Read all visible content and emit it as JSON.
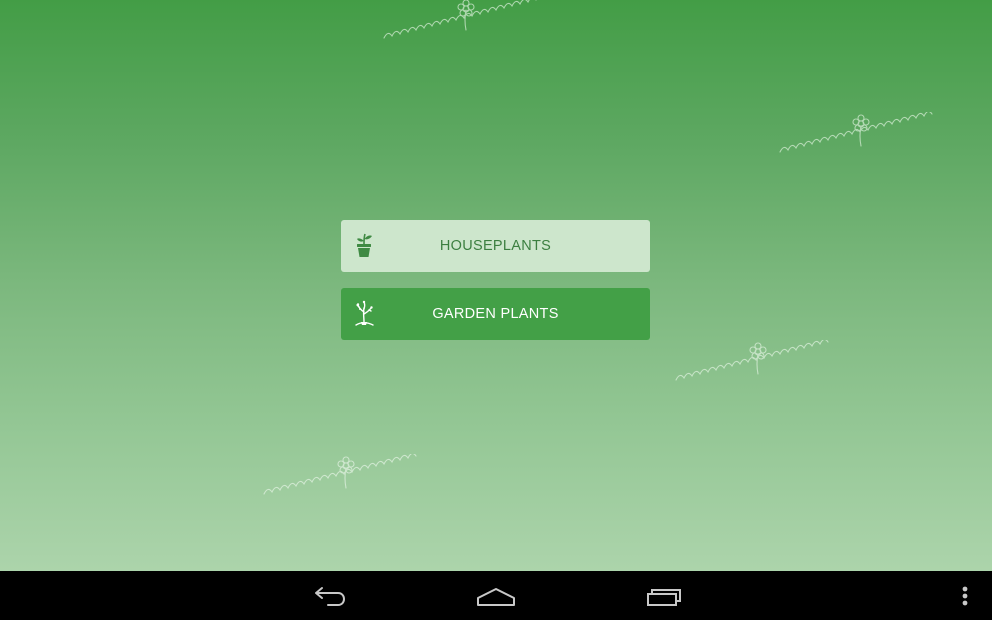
{
  "buttons": {
    "houseplants_label": "HOUSEPLANTS",
    "garden_plants_label": "GARDEN PLANTS"
  },
  "icons": {
    "houseplants": "potted-plant-icon",
    "garden_plants": "sprouting-tree-icon",
    "back": "back-arrow-icon",
    "home": "home-icon",
    "recents": "recent-apps-icon",
    "overflow": "overflow-menu-icon"
  },
  "colors": {
    "background_top": "#439d46",
    "background_bottom": "#acd4ab",
    "houseplants_button_bg": "#cde6cc",
    "houseplants_button_text": "#3c7f40",
    "garden_button_bg": "#43a047",
    "garden_button_text": "#ffffff",
    "navbar_bg": "#000000"
  }
}
